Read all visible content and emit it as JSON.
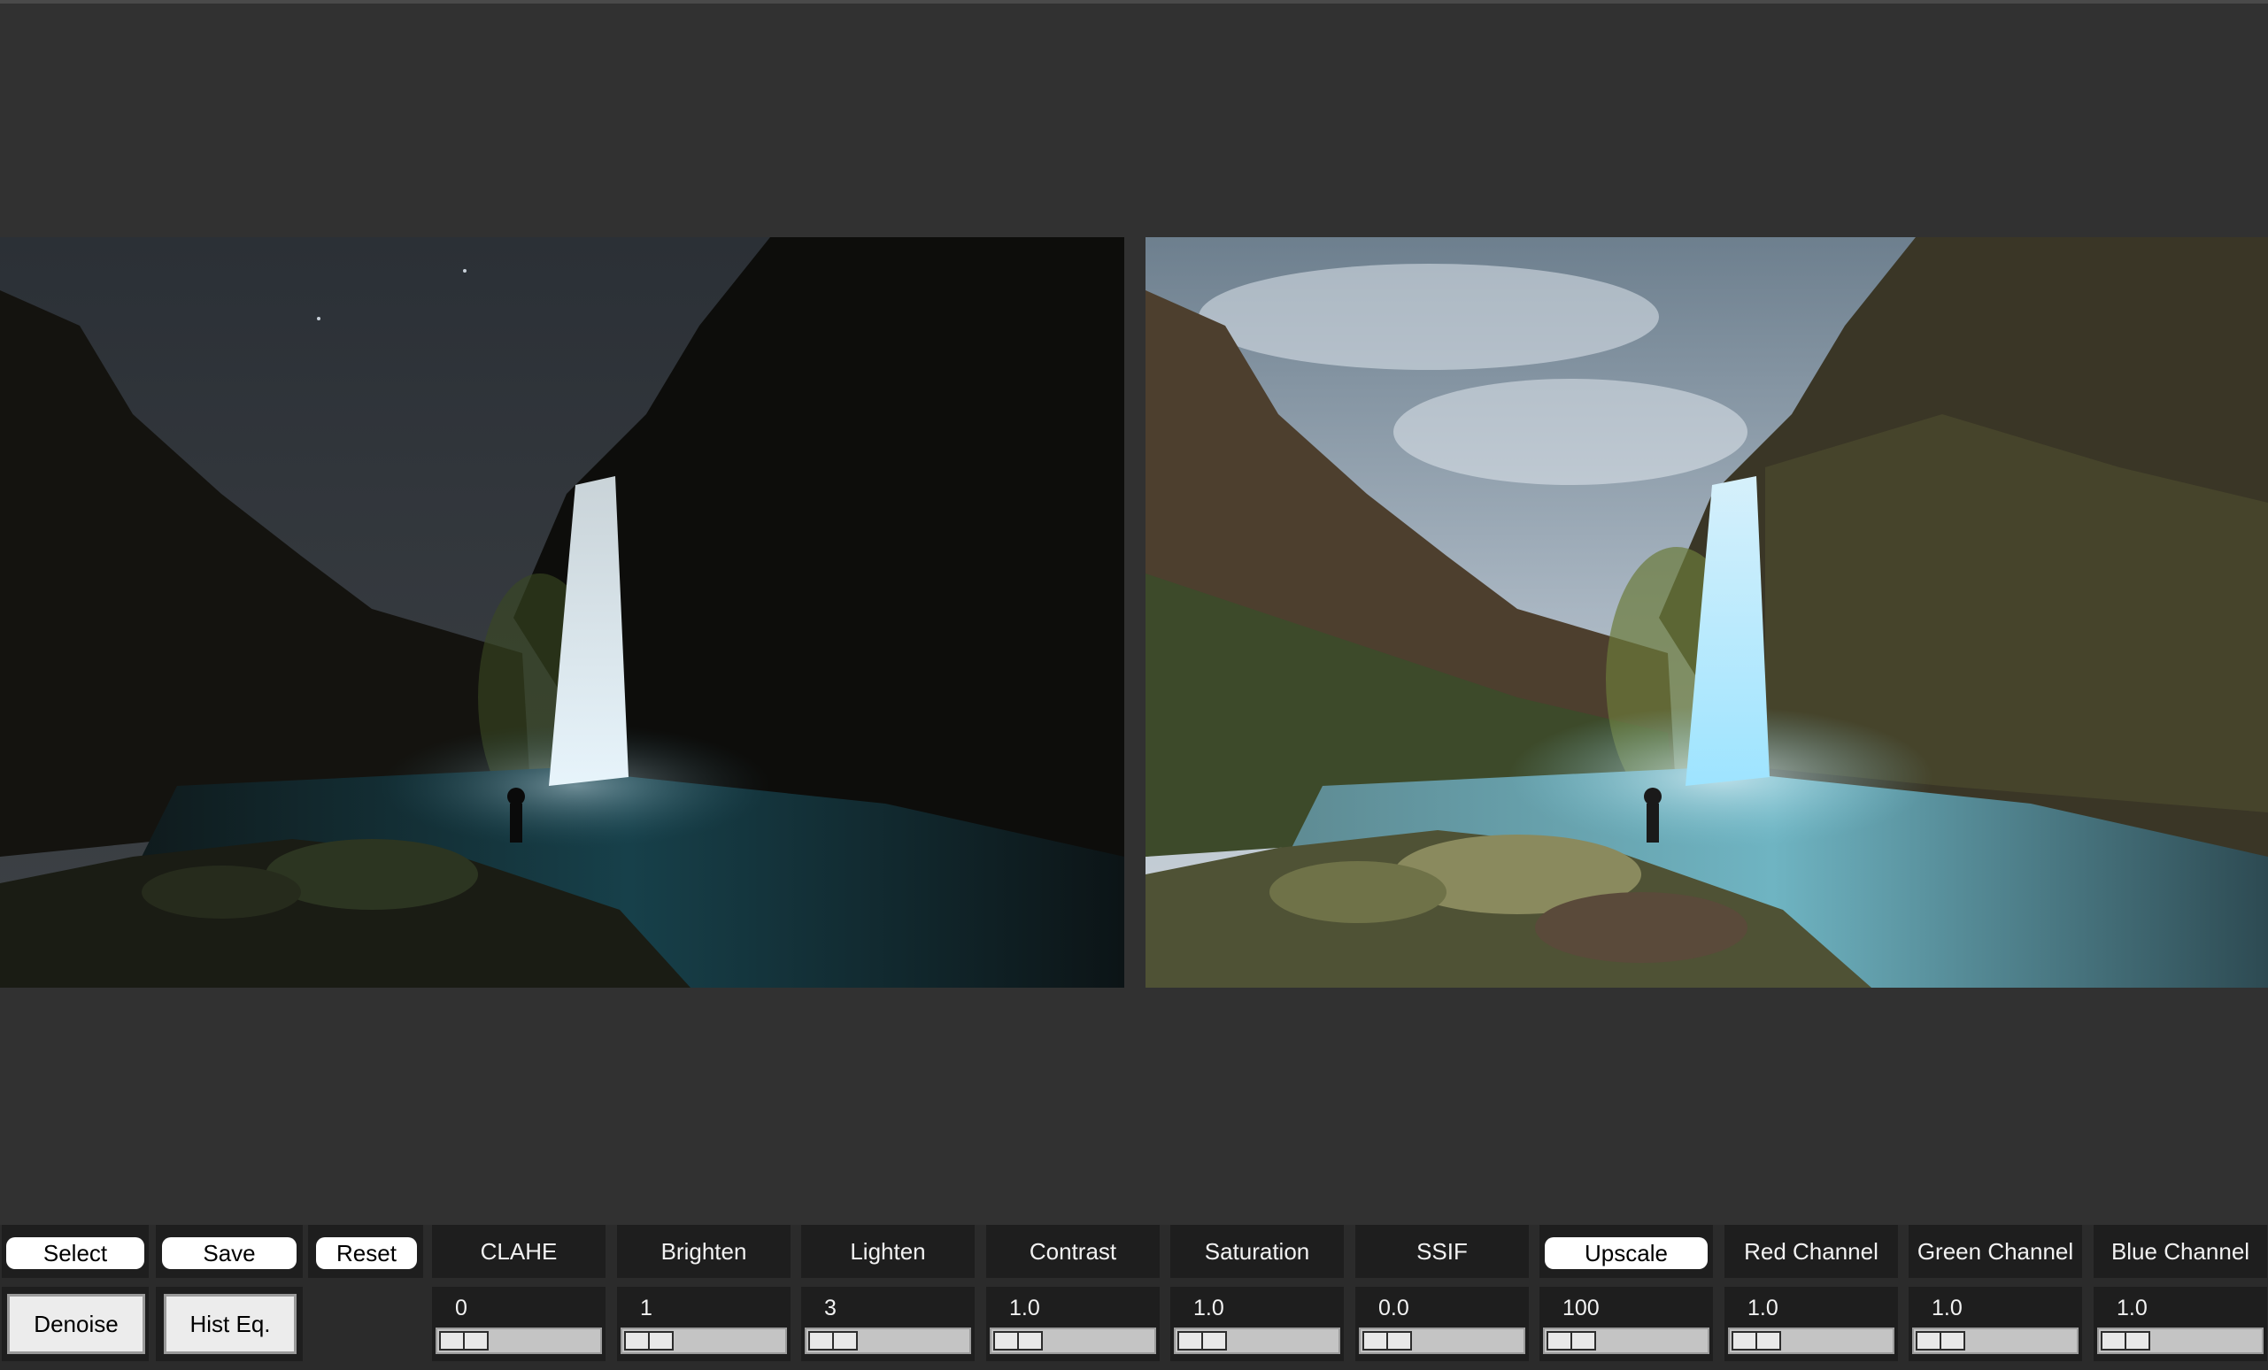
{
  "images": {
    "original": {
      "name": "original-photo"
    },
    "processed": {
      "name": "processed-photo"
    }
  },
  "toolbar": {
    "select_label": "Select",
    "save_label": "Save",
    "reset_label": "Reset",
    "denoise_label": "Denoise",
    "hist_eq_label": "Hist Eq."
  },
  "controls": [
    {
      "label": "CLAHE",
      "value": "0"
    },
    {
      "label": "Brighten",
      "value": "1"
    },
    {
      "label": "Lighten",
      "value": "3"
    },
    {
      "label": "Contrast",
      "value": "1.0"
    },
    {
      "label": "Saturation",
      "value": "1.0"
    },
    {
      "label": "SSIF",
      "value": "0.0"
    },
    {
      "label": "Upscale",
      "value": "100"
    },
    {
      "label": "Red Channel",
      "value": "1.0"
    },
    {
      "label": "Green Channel",
      "value": "1.0"
    },
    {
      "label": "Blue Channel",
      "value": "1.0"
    }
  ],
  "colors": {
    "background": "#313131",
    "button": "#ffffff",
    "cell": "#1e1e1e"
  }
}
